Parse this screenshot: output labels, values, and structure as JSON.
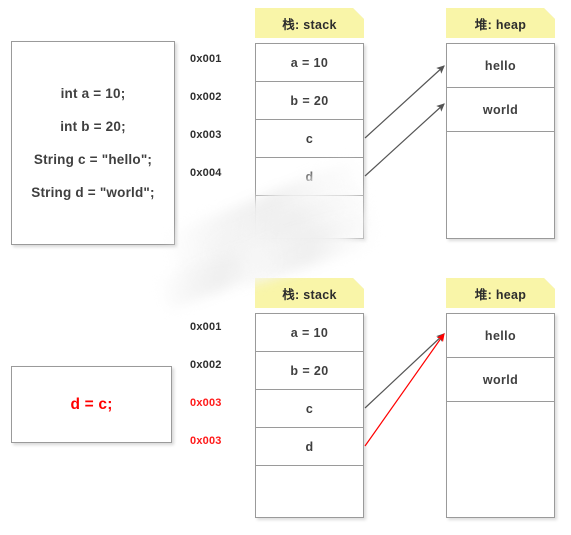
{
  "sections": [
    {
      "id": "declaration",
      "code_box": {
        "lines": [
          "int a = 10;",
          "int b = 20;",
          "String c = \"hello\";",
          "String d = \"world\";"
        ],
        "color": "#3f3f3f"
      },
      "addresses": [
        {
          "label": "0x001",
          "color": "#2f2f2f"
        },
        {
          "label": "0x002",
          "color": "#2f2f2f"
        },
        {
          "label": "0x003",
          "color": "#2f2f2f"
        },
        {
          "label": "0x004",
          "color": "#2f2f2f"
        }
      ],
      "stack": {
        "title": "栈: stack",
        "cells": [
          "a = 10",
          "b = 20",
          "c",
          "d"
        ]
      },
      "heap": {
        "title": "堆: heap",
        "cells": [
          "hello",
          "world"
        ]
      },
      "arrows": [
        {
          "from": "stack-c",
          "to": "heap-hello",
          "color": "#555555"
        },
        {
          "from": "stack-d",
          "to": "heap-world",
          "color": "#555555"
        }
      ]
    },
    {
      "id": "assignment",
      "code_box": {
        "lines": [
          "d = c;"
        ],
        "color": "#ff0000"
      },
      "addresses": [
        {
          "label": "0x001",
          "color": "#2f2f2f"
        },
        {
          "label": "0x002",
          "color": "#2f2f2f"
        },
        {
          "label": "0x003",
          "color": "#ff1a1a"
        },
        {
          "label": "0x003",
          "color": "#ff1a1a"
        }
      ],
      "stack": {
        "title": "栈: stack",
        "cells": [
          "a = 10",
          "b = 20",
          "c",
          "d"
        ]
      },
      "heap": {
        "title": "堆: heap",
        "cells": [
          "hello",
          "world"
        ]
      },
      "arrows": [
        {
          "from": "stack-c",
          "to": "heap-hello",
          "color": "#555555"
        },
        {
          "from": "stack-d",
          "to": "heap-hello",
          "color": "#ff0000"
        }
      ]
    }
  ],
  "palette": {
    "note_yellow": "#f9f5a8",
    "border_gray": "#9a9a9a",
    "text_dark": "#3f3f3f",
    "accent_red": "#ff0000"
  }
}
